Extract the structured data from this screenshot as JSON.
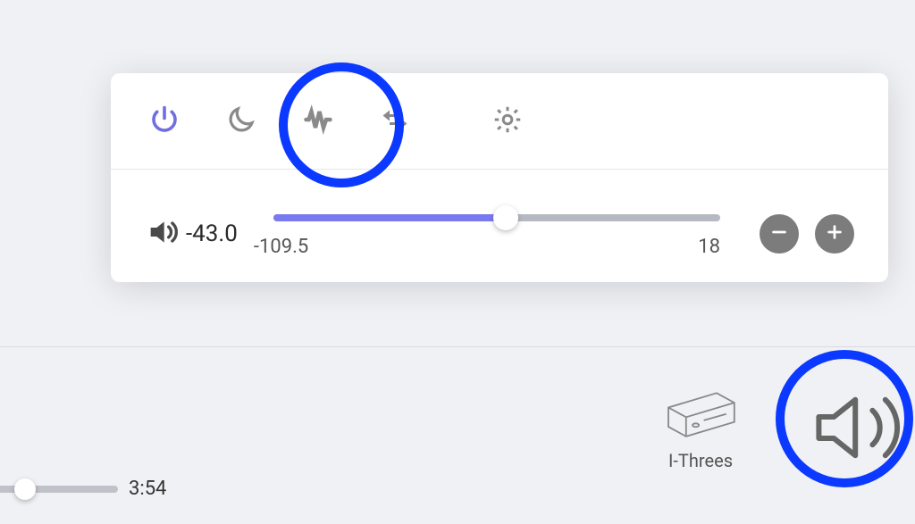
{
  "popup": {
    "toolbar": {
      "items": [
        {
          "name": "power-icon"
        },
        {
          "name": "moon-icon"
        },
        {
          "name": "waveform-icon"
        },
        {
          "name": "swap-icon"
        },
        {
          "name": "gear-icon"
        }
      ]
    },
    "volume": {
      "current": "-43.0",
      "min_label": "-109.5",
      "max_label": "18",
      "slider_percent": 52
    }
  },
  "player": {
    "elapsed": "3:54",
    "device_label": "I-Threes"
  }
}
